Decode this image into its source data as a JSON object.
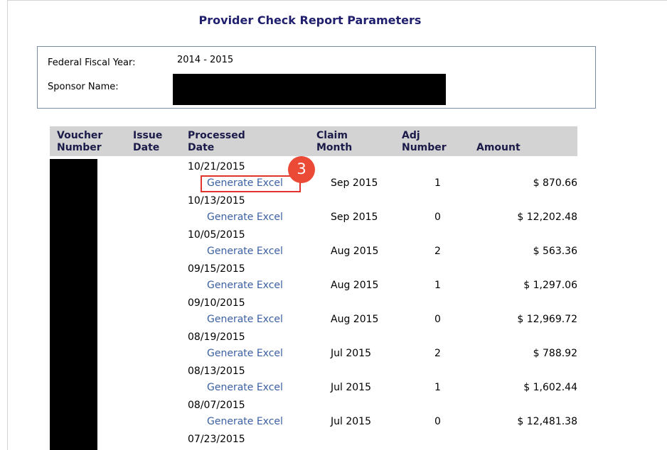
{
  "title": "Provider Check Report Parameters",
  "params": {
    "fiscal_year_label": "Federal Fiscal Year:",
    "fiscal_year_value": "2014 - 2015",
    "sponsor_label": "Sponsor Name:"
  },
  "table": {
    "headers": {
      "voucher": "Voucher Number",
      "issue_date": "Issue Date",
      "processed_date": "Processed Date",
      "claim_month": "Claim Month",
      "adj_number": "Adj Number",
      "amount": "Amount"
    },
    "link_label": "Generate Excel",
    "rows": [
      {
        "processed": "10/21/2015",
        "month": "Sep 2015",
        "adj": "1",
        "amount": "$ 870.66"
      },
      {
        "processed": "10/13/2015",
        "month": "Sep 2015",
        "adj": "0",
        "amount": "$ 12,202.48"
      },
      {
        "processed": "10/05/2015",
        "month": "Aug 2015",
        "adj": "2",
        "amount": "$ 563.36"
      },
      {
        "processed": "09/15/2015",
        "month": "Aug 2015",
        "adj": "1",
        "amount": "$ 1,297.06"
      },
      {
        "processed": "09/10/2015",
        "month": "Aug 2015",
        "adj": "0",
        "amount": "$ 12,969.72"
      },
      {
        "processed": "08/19/2015",
        "month": "Jul 2015",
        "adj": "2",
        "amount": "$ 788.92"
      },
      {
        "processed": "08/13/2015",
        "month": "Jul 2015",
        "adj": "1",
        "amount": "$ 1,602.44"
      },
      {
        "processed": "08/07/2015",
        "month": "Jul 2015",
        "adj": "0",
        "amount": "$ 12,481.38"
      }
    ],
    "trailing_date": "07/23/2015"
  },
  "callout": {
    "number": "3",
    "color": "#ea4a36",
    "border_color": "#e0342c"
  }
}
